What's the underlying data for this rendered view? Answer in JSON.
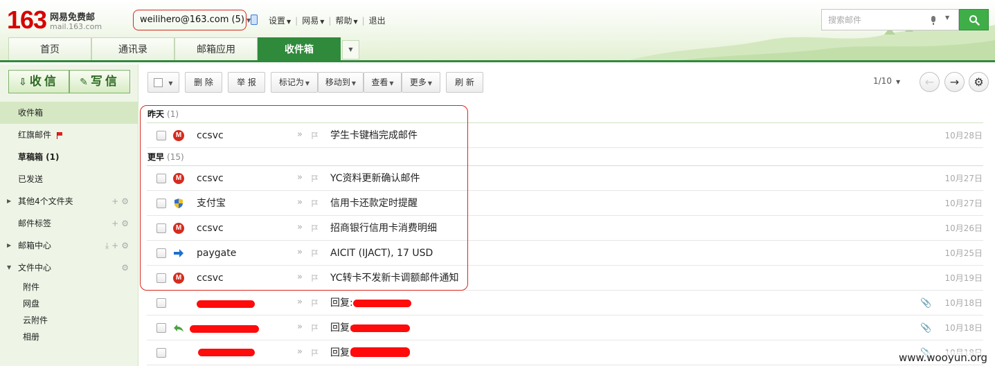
{
  "brand": {
    "number": "163",
    "name": "网易免费邮",
    "url": "mail.163.com",
    "brand_color": "#d60000"
  },
  "account": {
    "address": "weilihero@163.com (5)"
  },
  "top_links": [
    {
      "label": "设置"
    },
    {
      "label": "网易"
    },
    {
      "label": "帮助"
    },
    {
      "label": "退出"
    }
  ],
  "search": {
    "placeholder": "搜索邮件"
  },
  "tabs": [
    "首页",
    "通讯录",
    "邮箱应用",
    "收件箱"
  ],
  "sidebar": {
    "receive": "收信",
    "compose": "写信",
    "folders": [
      {
        "label": "收件箱"
      },
      {
        "label": "红旗邮件"
      },
      {
        "label": "草稿箱 (1)"
      },
      {
        "label": "已发送"
      },
      {
        "label": "其他4个文件夹"
      },
      {
        "label": "邮件标签"
      },
      {
        "label": "邮箱中心"
      },
      {
        "label": "文件中心"
      }
    ],
    "file_center_items": [
      "附件",
      "网盘",
      "云附件",
      "相册"
    ]
  },
  "toolbar": {
    "delete": "删 除",
    "report": "举 报",
    "mark_as": "标记为",
    "move_to": "移动到",
    "view": "查看",
    "more": "更多",
    "refresh": "刷 新",
    "page": "1/10"
  },
  "groups": [
    {
      "label": "昨天",
      "count": "(1)"
    },
    {
      "label": "更早",
      "count": "(15)"
    }
  ],
  "emails": [
    {
      "from": "ccsvc",
      "subject": "学生卡键档完成邮件",
      "date": "10月28日",
      "icon": "cmb-bank-icon"
    },
    {
      "from": "ccsvc",
      "subject": "YC资料更新确认邮件",
      "date": "10月27日",
      "icon": "cmb-bank-icon"
    },
    {
      "from": "支付宝",
      "subject": "信用卡还款定时提醒",
      "date": "10月27日",
      "icon": "shield-icon"
    },
    {
      "from": "ccsvc",
      "subject": "招商银行信用卡消费明细",
      "date": "10月26日",
      "icon": "cmb-bank-icon"
    },
    {
      "from": "paygate",
      "subject": "AICIT (IJACT), 17 USD",
      "date": "10月25日",
      "icon": "forward-arrow-icon"
    },
    {
      "from": "ccsvc",
      "subject": "YC转卡不发新卡调额邮件通知",
      "date": "10月19日",
      "icon": "cmb-bank-icon"
    },
    {
      "from": "",
      "subject": "回复:",
      "date": "10月18日",
      "icon": ""
    },
    {
      "from": "",
      "subject": "回复:",
      "date": "10月18日",
      "icon": "reply-arrow-icon"
    },
    {
      "from": "",
      "subject": "回复:",
      "date": "10月18日",
      "icon": ""
    }
  ],
  "watermark": "www.wooyun.org",
  "colors": {
    "accent_green": "#2f8a3b",
    "highlight_red": "#d9251c",
    "redaction": "#ff0b0b"
  }
}
